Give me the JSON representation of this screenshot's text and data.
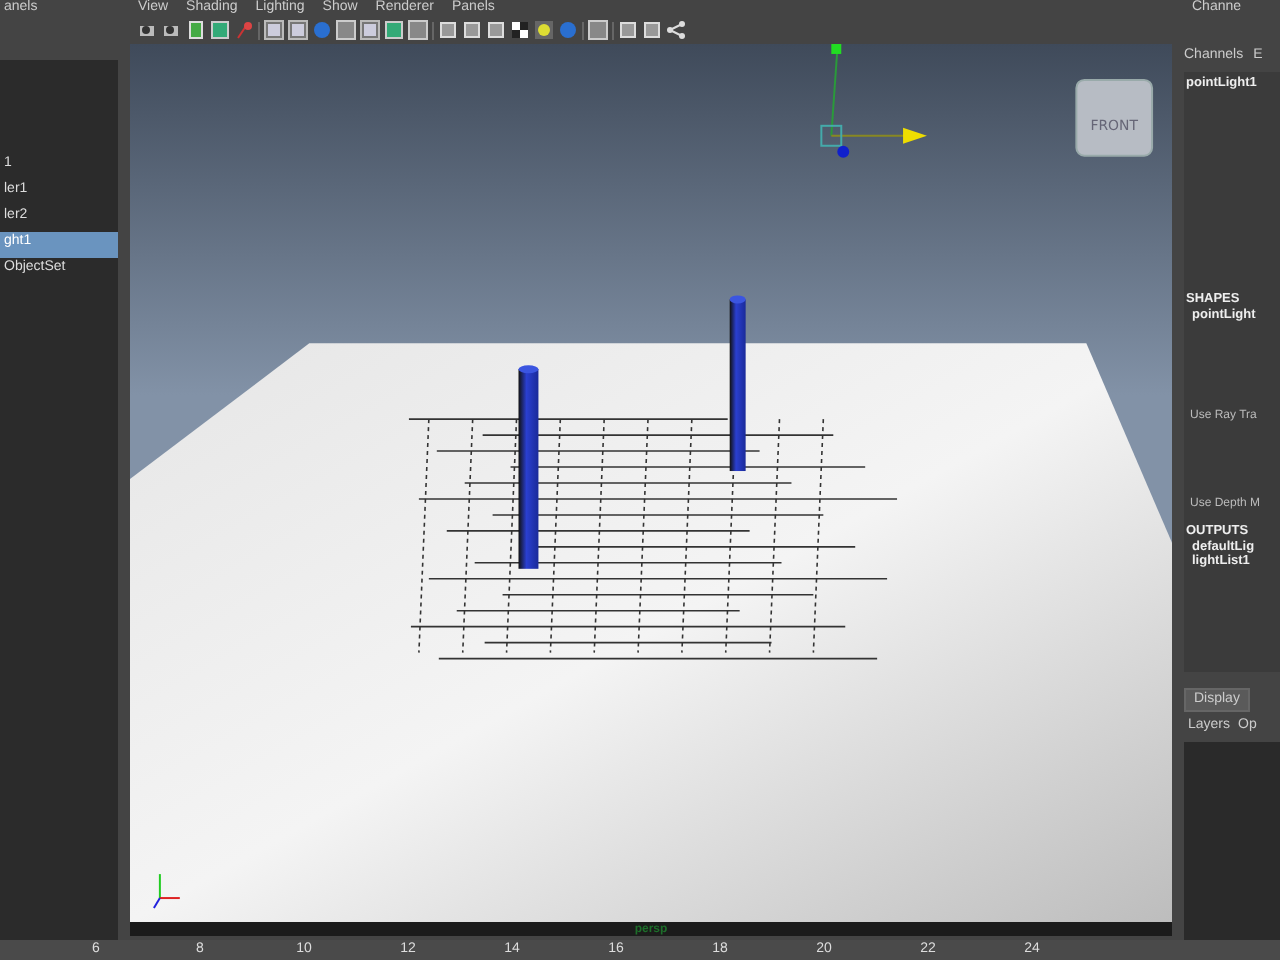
{
  "outliner": {
    "header": "anels",
    "items": [
      {
        "label": "1",
        "selected": false
      },
      {
        "label": "ler1",
        "selected": false
      },
      {
        "label": "ler2",
        "selected": false
      },
      {
        "label": "ght1",
        "selected": true
      },
      {
        "label": "ObjectSet",
        "selected": false
      }
    ]
  },
  "viewport": {
    "menu": [
      "View",
      "Shading",
      "Lighting",
      "Show",
      "Renderer",
      "Panels"
    ],
    "view_cube_label": "FRONT",
    "camera_label": "persp"
  },
  "channel_box": {
    "header": "Channe",
    "tabs": [
      "Channels",
      "E"
    ],
    "object": "pointLight1",
    "sections": [
      {
        "heading": "SHAPES",
        "items": [
          "pointLight"
        ]
      },
      {
        "attributes": [
          "Use Ray Tra",
          "Use Depth M"
        ]
      },
      {
        "heading": "OUTPUTS",
        "items": [
          "defaultLig",
          "lightList1"
        ]
      }
    ]
  },
  "layer_editor": {
    "tabs": [
      {
        "label": "Display",
        "selected": true
      }
    ],
    "menu": [
      "Layers",
      "Op"
    ]
  },
  "timeline": {
    "ticks": [
      "6",
      "8",
      "10",
      "12",
      "14",
      "16",
      "18",
      "20",
      "22",
      "24"
    ]
  }
}
